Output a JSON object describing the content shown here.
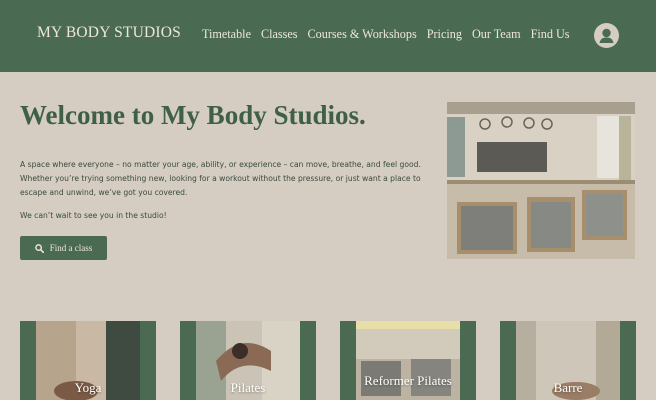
{
  "header": {
    "logo": "MY BODY STUDIOS",
    "nav": [
      "Timetable",
      "Classes",
      "Courses & Workshops",
      "Pricing",
      "Our Team",
      "Find Us"
    ],
    "account_icon": "user-icon"
  },
  "hero": {
    "title": "Welcome to My Body Studios.",
    "body": "A space where everyone – no matter your age, ability, or experience – can move, breathe, and feel good. Whether you’re trying something new, looking for a workout without the pressure, or just want a place to escape and unwind, we’ve got you covered.",
    "note": "We can’t wait to see you in the studio!",
    "cta_label": "Find a class",
    "cta_icon": "search-icon"
  },
  "classes": [
    {
      "label": "Yoga"
    },
    {
      "label": "Pilates"
    },
    {
      "label": "Reformer Pilates"
    },
    {
      "label": "Barre"
    }
  ],
  "colors": {
    "brand_green": "#4a6b52",
    "background": "#d5ccc2",
    "nav_text": "#eee6da"
  }
}
